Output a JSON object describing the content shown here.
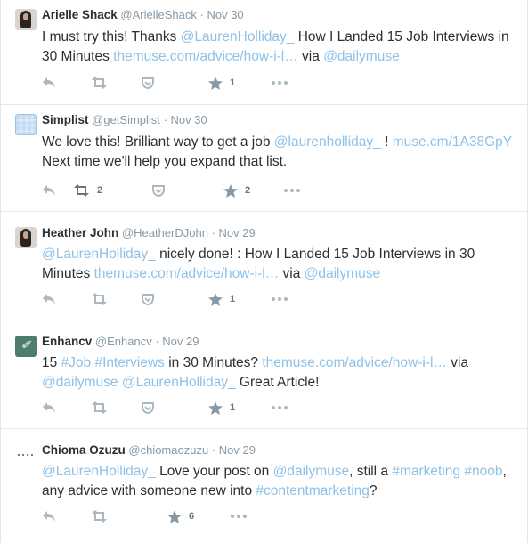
{
  "tweets": [
    {
      "name": "Arielle Shack",
      "handle": "@ArielleShack",
      "time": "Nov 30",
      "segments": [
        {
          "type": "text",
          "value": "I must try this! Thanks "
        },
        {
          "type": "mention",
          "value": "@LaurenHolliday_"
        },
        {
          "type": "text",
          "value": " How I Landed 15 Job Interviews in 30 Minutes "
        },
        {
          "type": "link",
          "value": "themuse.com/advice/how-i-l…"
        },
        {
          "type": "text",
          "value": " via "
        },
        {
          "type": "mention",
          "value": "@dailymuse"
        }
      ],
      "retweets": "",
      "favorites": "1"
    },
    {
      "name": "Simplist",
      "handle": "@getSimplist",
      "time": "Nov 30",
      "segments": [
        {
          "type": "text",
          "value": "We love this! Brilliant way to get a job "
        },
        {
          "type": "mention",
          "value": "@laurenholliday_"
        },
        {
          "type": "text",
          "value": " ! "
        },
        {
          "type": "link",
          "value": "muse.cm/1A38GpY"
        },
        {
          "type": "text",
          "value": " Next time we'll help you expand that list."
        }
      ],
      "retweets": "2",
      "favorites": "2"
    },
    {
      "name": "Heather John",
      "handle": "@HeatherDJohn",
      "time": "Nov 29",
      "segments": [
        {
          "type": "mention",
          "value": "@LaurenHolliday_"
        },
        {
          "type": "text",
          "value": " nicely done! : How I Landed 15 Job Interviews in 30 Minutes "
        },
        {
          "type": "link",
          "value": "themuse.com/advice/how-i-l…"
        },
        {
          "type": "text",
          "value": " via "
        },
        {
          "type": "mention",
          "value": "@dailymuse"
        }
      ],
      "retweets": "",
      "favorites": "1"
    },
    {
      "name": "Enhancv",
      "handle": "@Enhancv",
      "time": "Nov 29",
      "segments": [
        {
          "type": "text",
          "value": "15 "
        },
        {
          "type": "hashtag",
          "value": "#Job"
        },
        {
          "type": "text",
          "value": " "
        },
        {
          "type": "hashtag",
          "value": "#Interviews"
        },
        {
          "type": "text",
          "value": " in 30 Minutes? "
        },
        {
          "type": "link",
          "value": "themuse.com/advice/how-i-l…"
        },
        {
          "type": "text",
          "value": " via "
        },
        {
          "type": "mention",
          "value": "@dailymuse"
        },
        {
          "type": "text",
          "value": " "
        },
        {
          "type": "mention",
          "value": "@LaurenHolliday_"
        },
        {
          "type": "text",
          "value": " Great Article!"
        }
      ],
      "retweets": "",
      "favorites": "1"
    },
    {
      "name": "Chioma Ozuzu",
      "handle": "@chiomaozuzu",
      "time": "Nov 29",
      "segments": [
        {
          "type": "mention",
          "value": "@LaurenHolliday_"
        },
        {
          "type": "text",
          "value": " Love your post on "
        },
        {
          "type": "mention",
          "value": "@dailymuse"
        },
        {
          "type": "text",
          "value": ", still a "
        },
        {
          "type": "hashtag",
          "value": "#marketing"
        },
        {
          "type": "text",
          "value": " "
        },
        {
          "type": "hashtag",
          "value": "#noob"
        },
        {
          "type": "text",
          "value": ", any advice with someone new into "
        },
        {
          "type": "hashtag",
          "value": "#contentmarketing"
        },
        {
          "type": "text",
          "value": "?"
        }
      ],
      "retweets": "",
      "favorites": "6"
    }
  ],
  "icons": {
    "reply": "reply-icon",
    "retweet": "retweet-icon",
    "pocket": "pocket-icon",
    "favorite": "star-icon",
    "more": "more-icon"
  },
  "colors": {
    "link": "#8ec1e8",
    "meta": "#8899a6",
    "text": "#292f33",
    "icon": "#aab8c2",
    "divider": "#e1e8ed"
  },
  "separator": "·"
}
